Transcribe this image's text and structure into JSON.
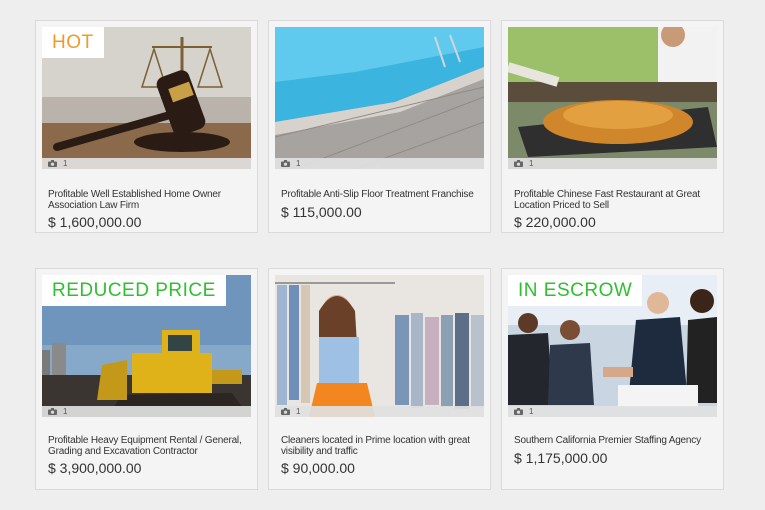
{
  "listings": [
    {
      "badge": "HOT",
      "badge_color": "#f39a22",
      "photo_count": "1",
      "title": "Profitable Well Established Home Owner Association Law Firm",
      "price": "$ 1,600,000.00",
      "image": "judge-gavel"
    },
    {
      "badge": "",
      "badge_color": "",
      "photo_count": "1",
      "title": "Profitable Anti-Slip Floor Treatment Franchise",
      "price": "$ 115,000.00",
      "image": "swimming-pool-deck"
    },
    {
      "badge": "",
      "badge_color": "",
      "photo_count": "1",
      "title": "Profitable Chinese Fast Restaurant at Great Location Priced to Sell",
      "price": "$ 220,000.00",
      "image": "noodle-food-stall"
    },
    {
      "badge": "REDUCED PRICE",
      "badge_color": "#2fbf2f",
      "photo_count": "1",
      "title": "Profitable Heavy Equipment Rental / General, Grading and Excavation Contractor",
      "price": "$ 3,900,000.00",
      "image": "bulldozer"
    },
    {
      "badge": "",
      "badge_color": "",
      "photo_count": "1",
      "title": "Cleaners located in Prime location with great visibility and traffic",
      "price": "$ 90,000.00",
      "image": "clothes-rack-woman"
    },
    {
      "badge": "IN ESCROW",
      "badge_color": "#2fbf2f",
      "photo_count": "1",
      "title": "Southern California Premier Staffing Agency",
      "price": "$ 1,175,000.00",
      "image": "business-handshake"
    }
  ]
}
